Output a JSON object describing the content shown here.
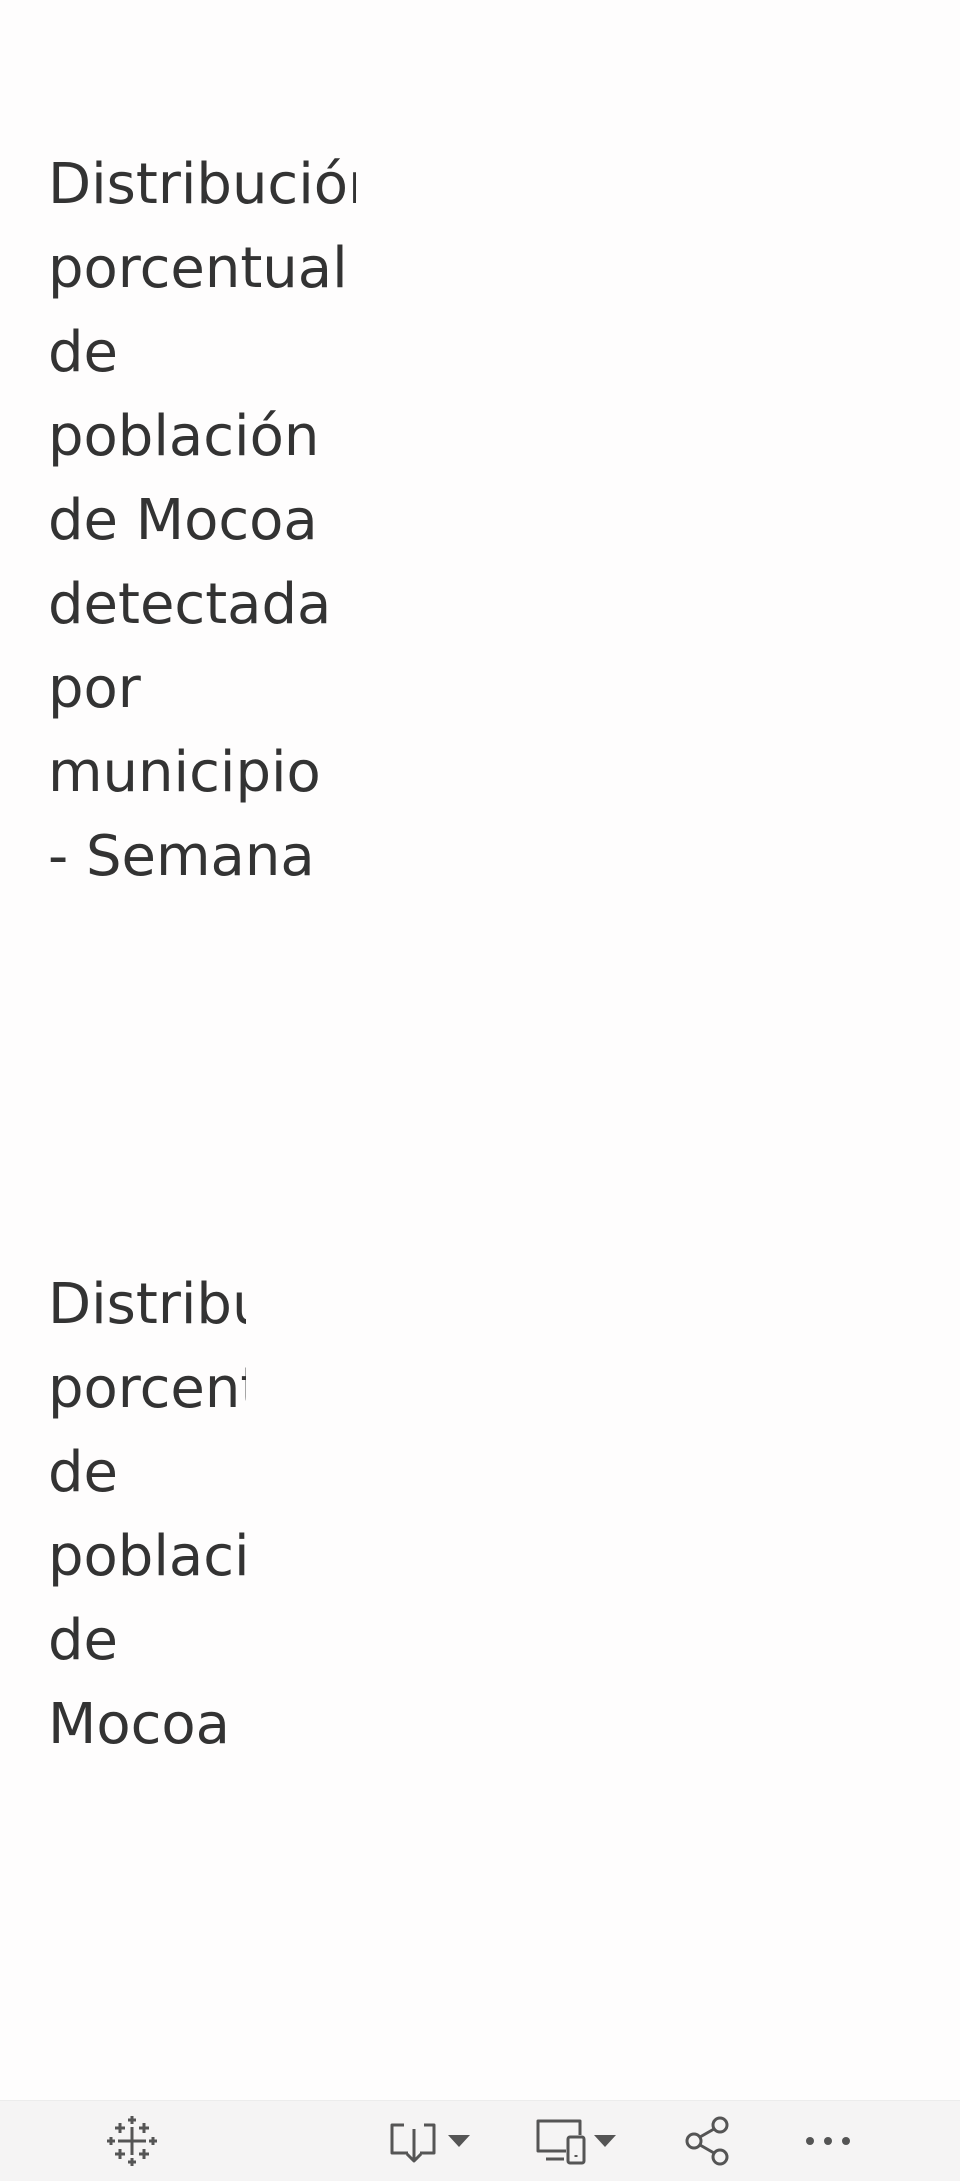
{
  "sheets": [
    {
      "title": "Distribución\nporcentual\nde\npoblación\nde Mocoa\ndetectada\npor\nmunicipio\n- Semana"
    },
    {
      "title": "Distribución\nporcentual\nde\npoblación\nde\nMocoa"
    }
  ],
  "toolbar": {
    "icons": [
      "tableau-logo-icon",
      "download-icon",
      "device-layout-icon",
      "share-icon",
      "more-options-icon"
    ],
    "icon_color": "#555555"
  }
}
